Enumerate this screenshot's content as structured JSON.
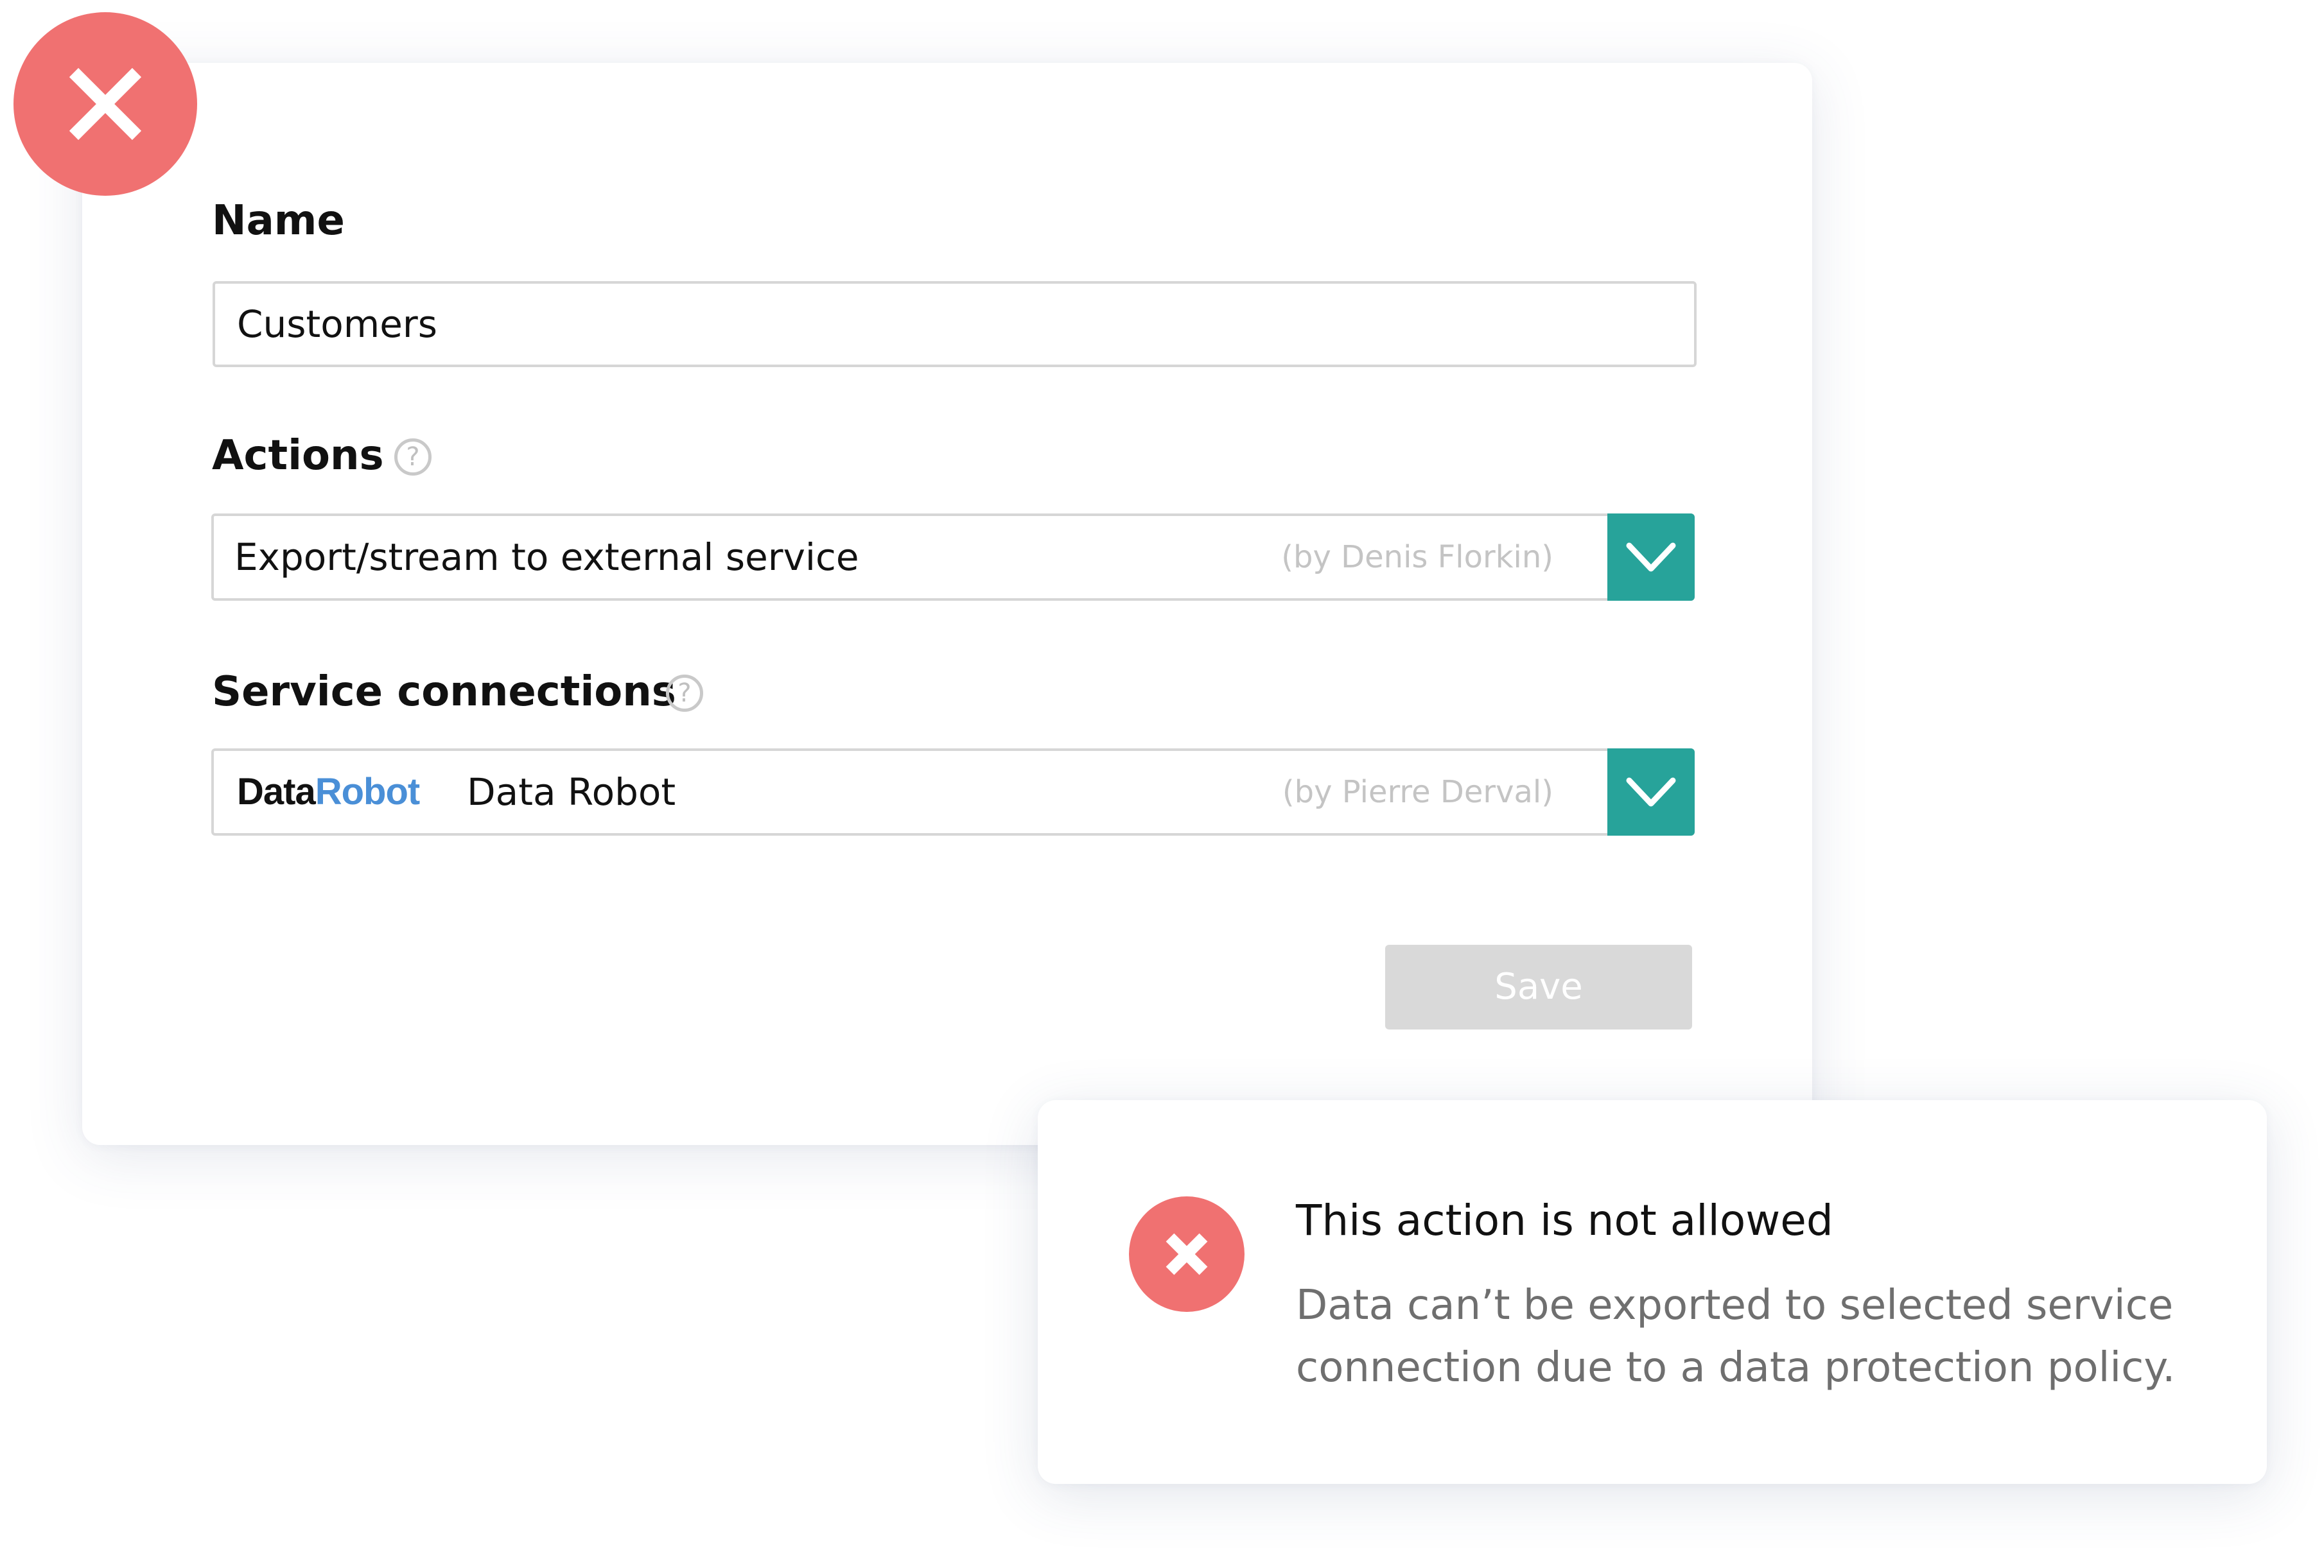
{
  "form": {
    "name_label": "Name",
    "name_value": "Customers",
    "actions_label": "Actions",
    "actions_help_icon": "question-circle-icon",
    "actions_selected": "Export/stream to external service",
    "actions_owner": "(by Denis Florkin)",
    "service_label": "Service connections",
    "service_help_icon": "question-circle-icon",
    "service_brand_part1": "Data",
    "service_brand_part2": "Robot",
    "service_selected": "Data Robot",
    "service_owner": "(by Pierre Derval)",
    "save_label": "Save",
    "save_enabled": false
  },
  "error_badge_icon": "close-icon",
  "toast": {
    "icon": "close-icon",
    "title": "This action is not allowed",
    "message": "Data can’t be exported to selected service connection due to a data protection policy."
  },
  "colors": {
    "error": "#f07171",
    "accent": "#27a39a",
    "brand_blue": "#4a8fd7",
    "disabled": "#d9d9d9"
  }
}
